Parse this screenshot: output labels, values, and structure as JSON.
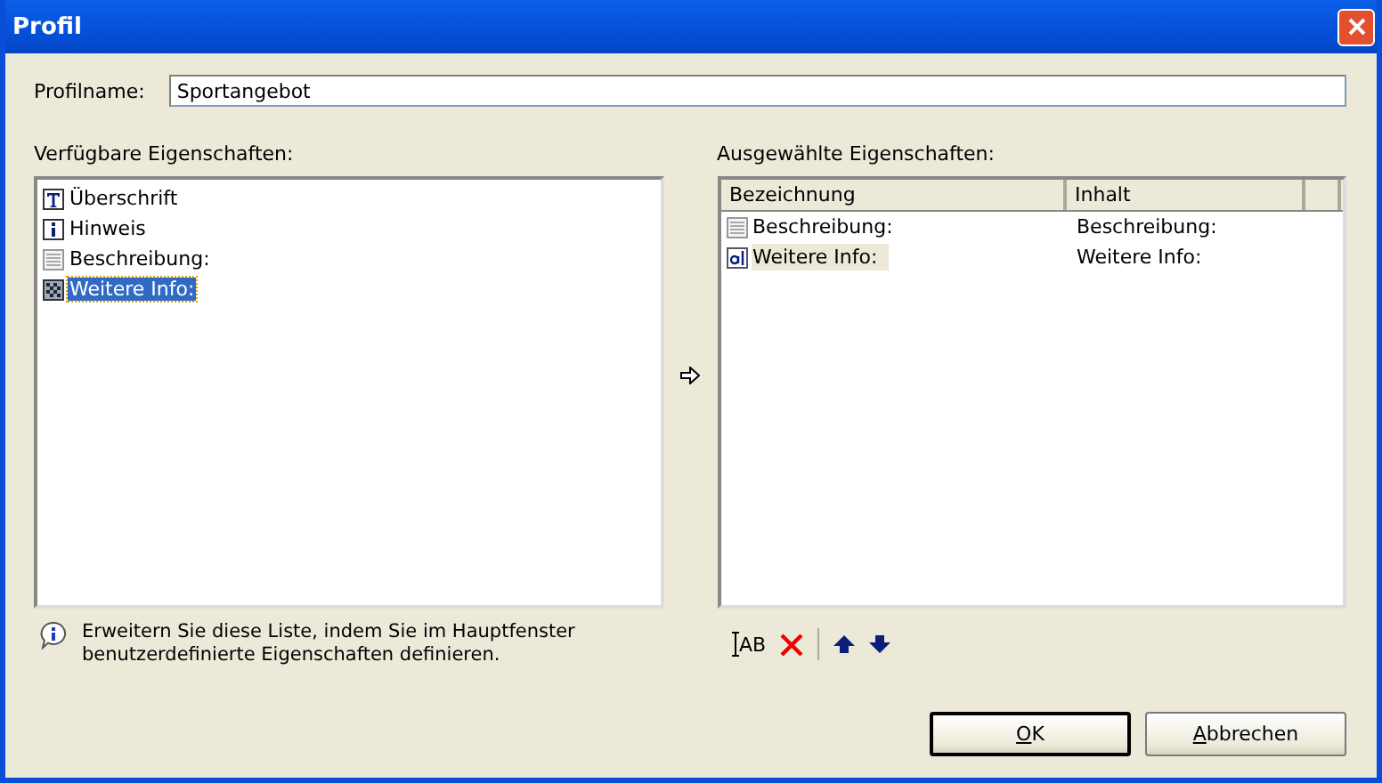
{
  "window": {
    "title": "Profil"
  },
  "profile_name": {
    "label": "Profilname:",
    "value": "Sportangebot"
  },
  "available": {
    "label": "Verfügbare Eigenschaften:",
    "items": [
      {
        "kind": "heading",
        "label": "Überschrift",
        "selected": false
      },
      {
        "kind": "info",
        "label": "Hinweis",
        "selected": false
      },
      {
        "kind": "lines",
        "label": "Beschreibung:",
        "selected": false
      },
      {
        "kind": "pattern",
        "label": "Weitere Info:",
        "selected": true
      }
    ]
  },
  "selected_properties": {
    "label": "Ausgewählte Eigenschaften:",
    "columns": [
      "Bezeichnung",
      "Inhalt"
    ],
    "rows": [
      {
        "kind": "lines",
        "name": "Beschreibung:",
        "content": "Beschreibung:",
        "selected": false
      },
      {
        "kind": "field",
        "name": "Weitere Info:",
        "content": "Weitere Info:",
        "selected": true
      }
    ]
  },
  "hint": "Erweitern Sie diese Liste, indem Sie im Hauptfenster benutzerdefinierte Eigenschaften definieren.",
  "rename_tool": "AB",
  "buttons": [
    {
      "label": "OK",
      "default": true,
      "underline_first": true
    },
    {
      "label": "Abbrechen",
      "default": false,
      "underline_first": true
    }
  ]
}
